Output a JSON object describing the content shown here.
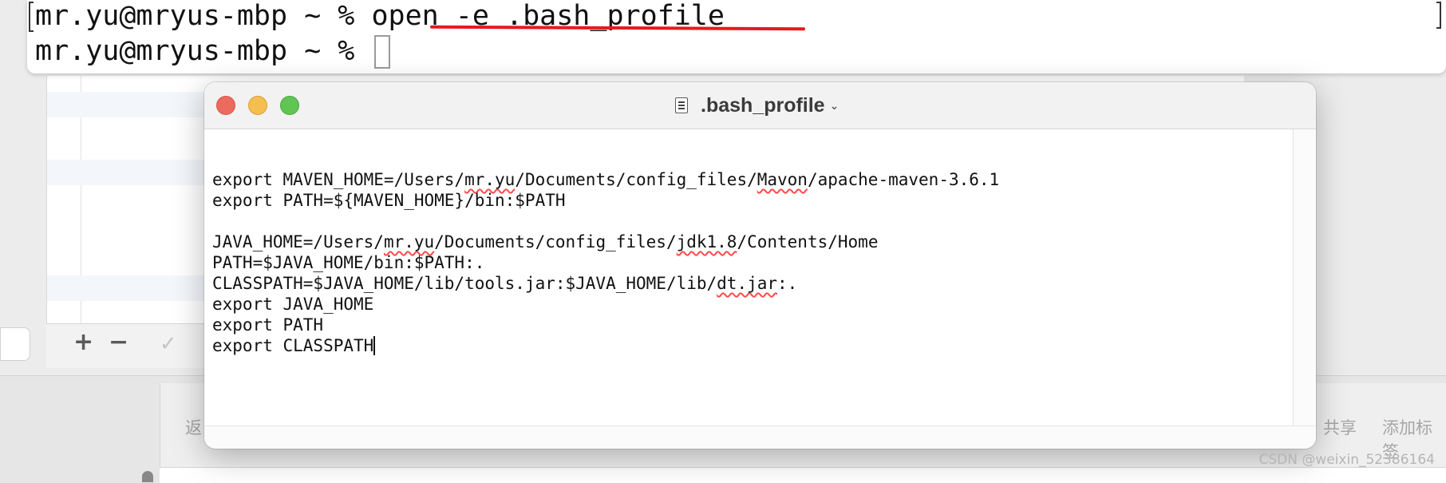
{
  "terminal": {
    "line1_prompt": "mr.yu@mryus-mbp ~ % ",
    "line1_command": "open -e .bash_profile",
    "line2_prompt": "mr.yu@mryus-mbp ~ % "
  },
  "editor": {
    "title": ".bash_profile",
    "lines": [
      "export MAVEN_HOME=/Users/mr.yu/Documents/config_files/Mavon/apache-maven-3.6.1",
      "export PATH=${MAVEN_HOME}/bin:$PATH",
      "",
      "JAVA_HOME=/Users/mr.yu/Documents/config_files/jdk1.8/Contents/Home",
      "PATH=$JAVA_HOME/bin:$PATH:.",
      "CLASSPATH=$JAVA_HOME/lib/tools.jar:$JAVA_HOME/lib/dt.jar:.",
      "export JAVA_HOME",
      "export PATH",
      "export CLASSPATH"
    ]
  },
  "background": {
    "toolbar_add": "+",
    "toolbar_remove": "−",
    "toolbar_check": "✓",
    "bottom_left_text": "返",
    "bottom_share": "共享",
    "bottom_add_tag": "添加标签"
  },
  "watermark": "CSDN @weixin_52386164",
  "colors": {
    "annotation_red": "#e8191e",
    "close": "#ed6a5e",
    "minimize": "#f5bf4f",
    "maximize": "#61c554",
    "spellcheck": "#ff4b4b"
  },
  "icons": {
    "document": "document-icon",
    "chevron": "chevron-down-icon"
  }
}
